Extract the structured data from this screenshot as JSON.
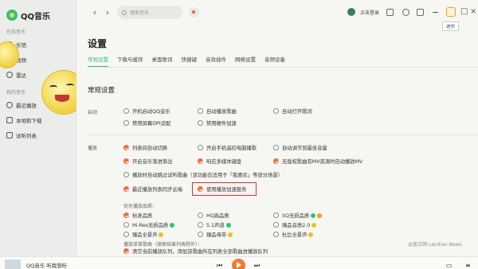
{
  "app": {
    "name": "QQ音乐"
  },
  "sidebar": {
    "online_section": "在线音乐",
    "online_items": [
      {
        "label": "乐馆",
        "icon": "music-hall-icon"
      },
      {
        "label": "视频",
        "icon": "video-icon"
      },
      {
        "label": "雷达",
        "icon": "radar-icon"
      }
    ],
    "my_section": "我的音乐",
    "my_items": [
      {
        "label": "最近播放",
        "icon": "clock-icon"
      },
      {
        "label": "本地和下载",
        "icon": "download-icon"
      },
      {
        "label": "试听列表",
        "icon": "list-icon"
      }
    ]
  },
  "topbar": {
    "search_placeholder": "搜索音乐",
    "login": "点击登录",
    "tooltip": "迷你"
  },
  "page": {
    "title": "设置",
    "tabs": [
      "常规设置",
      "下载与缓存",
      "桌面歌词",
      "快捷键",
      "音效插件",
      "网络设置",
      "音频设备"
    ],
    "active_tab": 0
  },
  "general": {
    "section_title": "常规设置",
    "startup_label": "启动",
    "startup_options": [
      {
        "label": "开机启动QQ音乐",
        "checked": false
      },
      {
        "label": "自动播放歌曲",
        "checked": false
      },
      {
        "label": "自动打开歌词",
        "checked": false
      },
      {
        "label": "禁用屏幕DPI适配",
        "checked": false
      },
      {
        "label": "禁用硬件加速",
        "checked": false
      }
    ],
    "play_label": "播放",
    "play_options": [
      {
        "label": "列表间自动切换",
        "checked": true
      },
      {
        "label": "开启手机遥控电脑播歌",
        "checked": false
      },
      {
        "label": "自动调节到最佳音量",
        "checked": false
      },
      {
        "label": "开启音乐渐进渐出",
        "checked": true
      },
      {
        "label": "响应多媒体键盘",
        "checked": true
      },
      {
        "label": "无版权歌曲有MV资源时自动播放MV",
        "checked": true
      },
      {
        "label": "播放时自动跳过试听歌曲（该功能仅适用于「我喜欢」等部分场景）",
        "checked": false
      },
      {
        "label": "最近播放列表同步云端",
        "checked": true
      },
      {
        "label": "使用播放加速服务",
        "checked": true
      }
    ],
    "quality_label": "优先播放品质：",
    "quality_options": [
      {
        "label": "标准品质",
        "checked": true
      },
      {
        "label": "HQ高品质",
        "checked": false
      },
      {
        "label": "SQ无损品质",
        "checked": false
      },
      {
        "label": "Hi-Res无损品质",
        "checked": false
      },
      {
        "label": "5.1声道",
        "checked": false
      },
      {
        "label": "臻品音质2.0",
        "checked": false
      },
      {
        "label": "臻品全景声",
        "checked": false
      },
      {
        "label": "臻品母带",
        "checked": false
      },
      {
        "label": "杜比全景声",
        "checked": false
      }
    ],
    "queue_label": "播放单首歌曲（搜索结果列表除外）：",
    "queue_option": "清空当前播放队列，添加该歌曲所在列表全部歌曲进播放队列"
  },
  "player": {
    "now_playing": "QQ音乐 听我想听"
  },
  "watermark": "@蓝点网 Landian.News",
  "colors": {
    "accent": "#31c27c",
    "check": "#f06a3a",
    "highlight": "#e5322d"
  }
}
